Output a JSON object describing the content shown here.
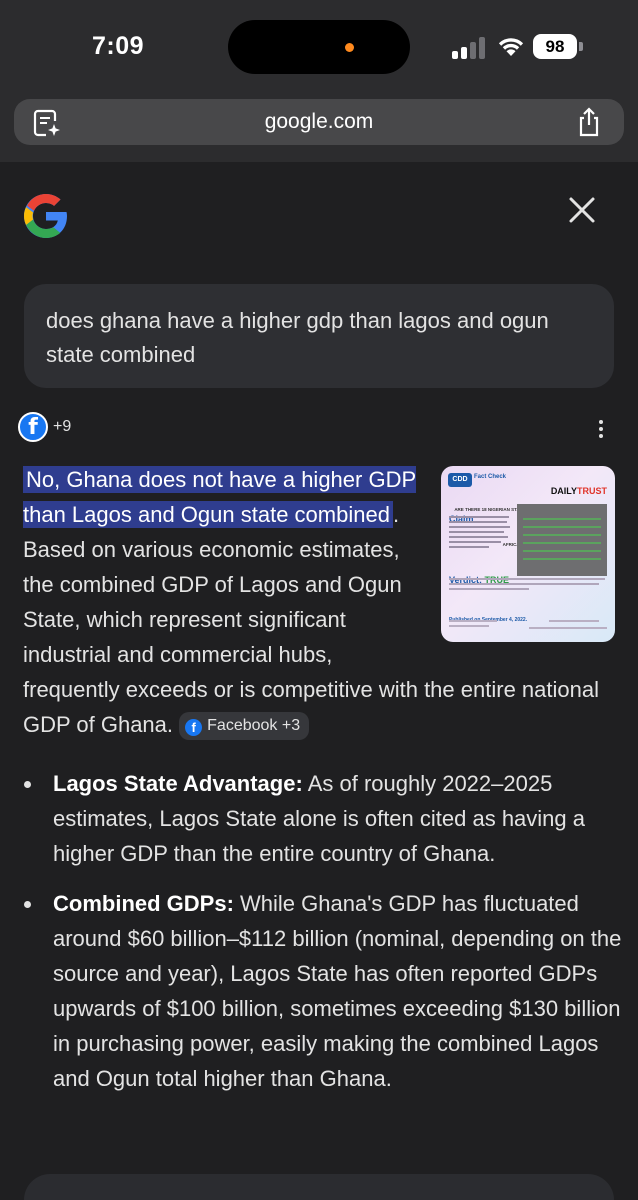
{
  "status_bar": {
    "time": "7:09",
    "battery": "98"
  },
  "browser": {
    "url": "google.com"
  },
  "query": "does ghana have a higher gdp than lagos and ogun state combined",
  "sources": {
    "count_label": "+9"
  },
  "answer": {
    "highlight": "No, Ghana does not have a higher GDP than Lagos and Ogun state combined",
    "body": ". Based on various economic estimates, the combined GDP of Lagos and Ogun State, which represent significant industrial and commercial hubs, frequently exceeds or is competitive with the entire national GDP of Ghana.",
    "citation_label": "Facebook +3"
  },
  "thumbnail": {
    "cdd": "CDD",
    "fact_check": "Fact Check",
    "daily": "DAILY",
    "trust": "TRUST",
    "headline": "ARE THERE 18 NIGERIAN STATES WITH BIGGER GDPs THAN SOME AFRICAN COUNTRIES?",
    "claim": "Claim",
    "verdict": "Verdict:",
    "verdict_value": "TRUE",
    "published": "Published on September 4, 2022."
  },
  "bullets": [
    {
      "title": "Lagos State Advantage:",
      "text": " As of roughly 2022–2025 estimates, Lagos State alone is often cited as having a higher GDP than the entire country of Ghana."
    },
    {
      "title": "Combined GDPs:",
      "text": " While Ghana's GDP has fluctuated around $60 billion–$112 billion (nominal, depending on the source and year), Lagos State has often reported GDPs upwards of $100 billion, sometimes exceeding $130 billion in purchasing power, easily making the combined Lagos and Ogun total higher than Ghana."
    }
  ],
  "colors": {
    "background": "#1f1f21",
    "highlight": "#2f3d8f",
    "facebook": "#1877f2",
    "text": "#e3e3e3"
  },
  "icons": [
    "reader-icon",
    "share-icon",
    "google-logo",
    "close-icon",
    "facebook-icon",
    "more-vert-icon"
  ]
}
